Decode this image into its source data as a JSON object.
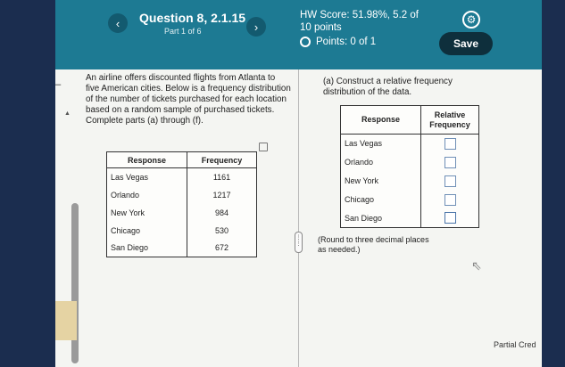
{
  "header": {
    "question_title": "Question 8, 2.1.15",
    "part": "Part 1 of 6",
    "prev_icon": "‹",
    "next_icon": "›",
    "hw_score_line1": "HW Score: 51.98%, 5.2 of",
    "hw_score_line2": "10 points",
    "points": "Points: 0 of 1",
    "settings_icon": "⚙",
    "save_label": "Save"
  },
  "nav": {
    "back_icon": "←"
  },
  "problem": {
    "text": "An airline offers discounted flights from Atlanta to five American cities. Below is a frequency distribution of the number of tickets purchased for each location based on a random sample of purchased tickets. Complete parts (a) through (f).",
    "table": {
      "headers": [
        "Response",
        "Frequency"
      ],
      "rows": [
        [
          "Las Vegas",
          "1161"
        ],
        [
          "Orlando",
          "1217"
        ],
        [
          "New York",
          "984"
        ],
        [
          "Chicago",
          "530"
        ],
        [
          "San Diego",
          "672"
        ]
      ]
    }
  },
  "part_a": {
    "instruction": "(a) Construct a relative frequency distribution of the data.",
    "table": {
      "header_response": "Response",
      "header_rel_line1": "Relative",
      "header_rel_line2": "Frequency",
      "rows": [
        "Las Vegas",
        "Orlando",
        "New York",
        "Chicago",
        "San Diego"
      ]
    },
    "hint_line1": "(Round to three decimal places",
    "hint_line2": "as needed.)"
  },
  "footer": {
    "partial_credit": "Partial Cred"
  },
  "colors": {
    "header_bg": "#1d7a93",
    "save_bg": "#0e2f3c",
    "input_border": "#6f8fb6"
  }
}
